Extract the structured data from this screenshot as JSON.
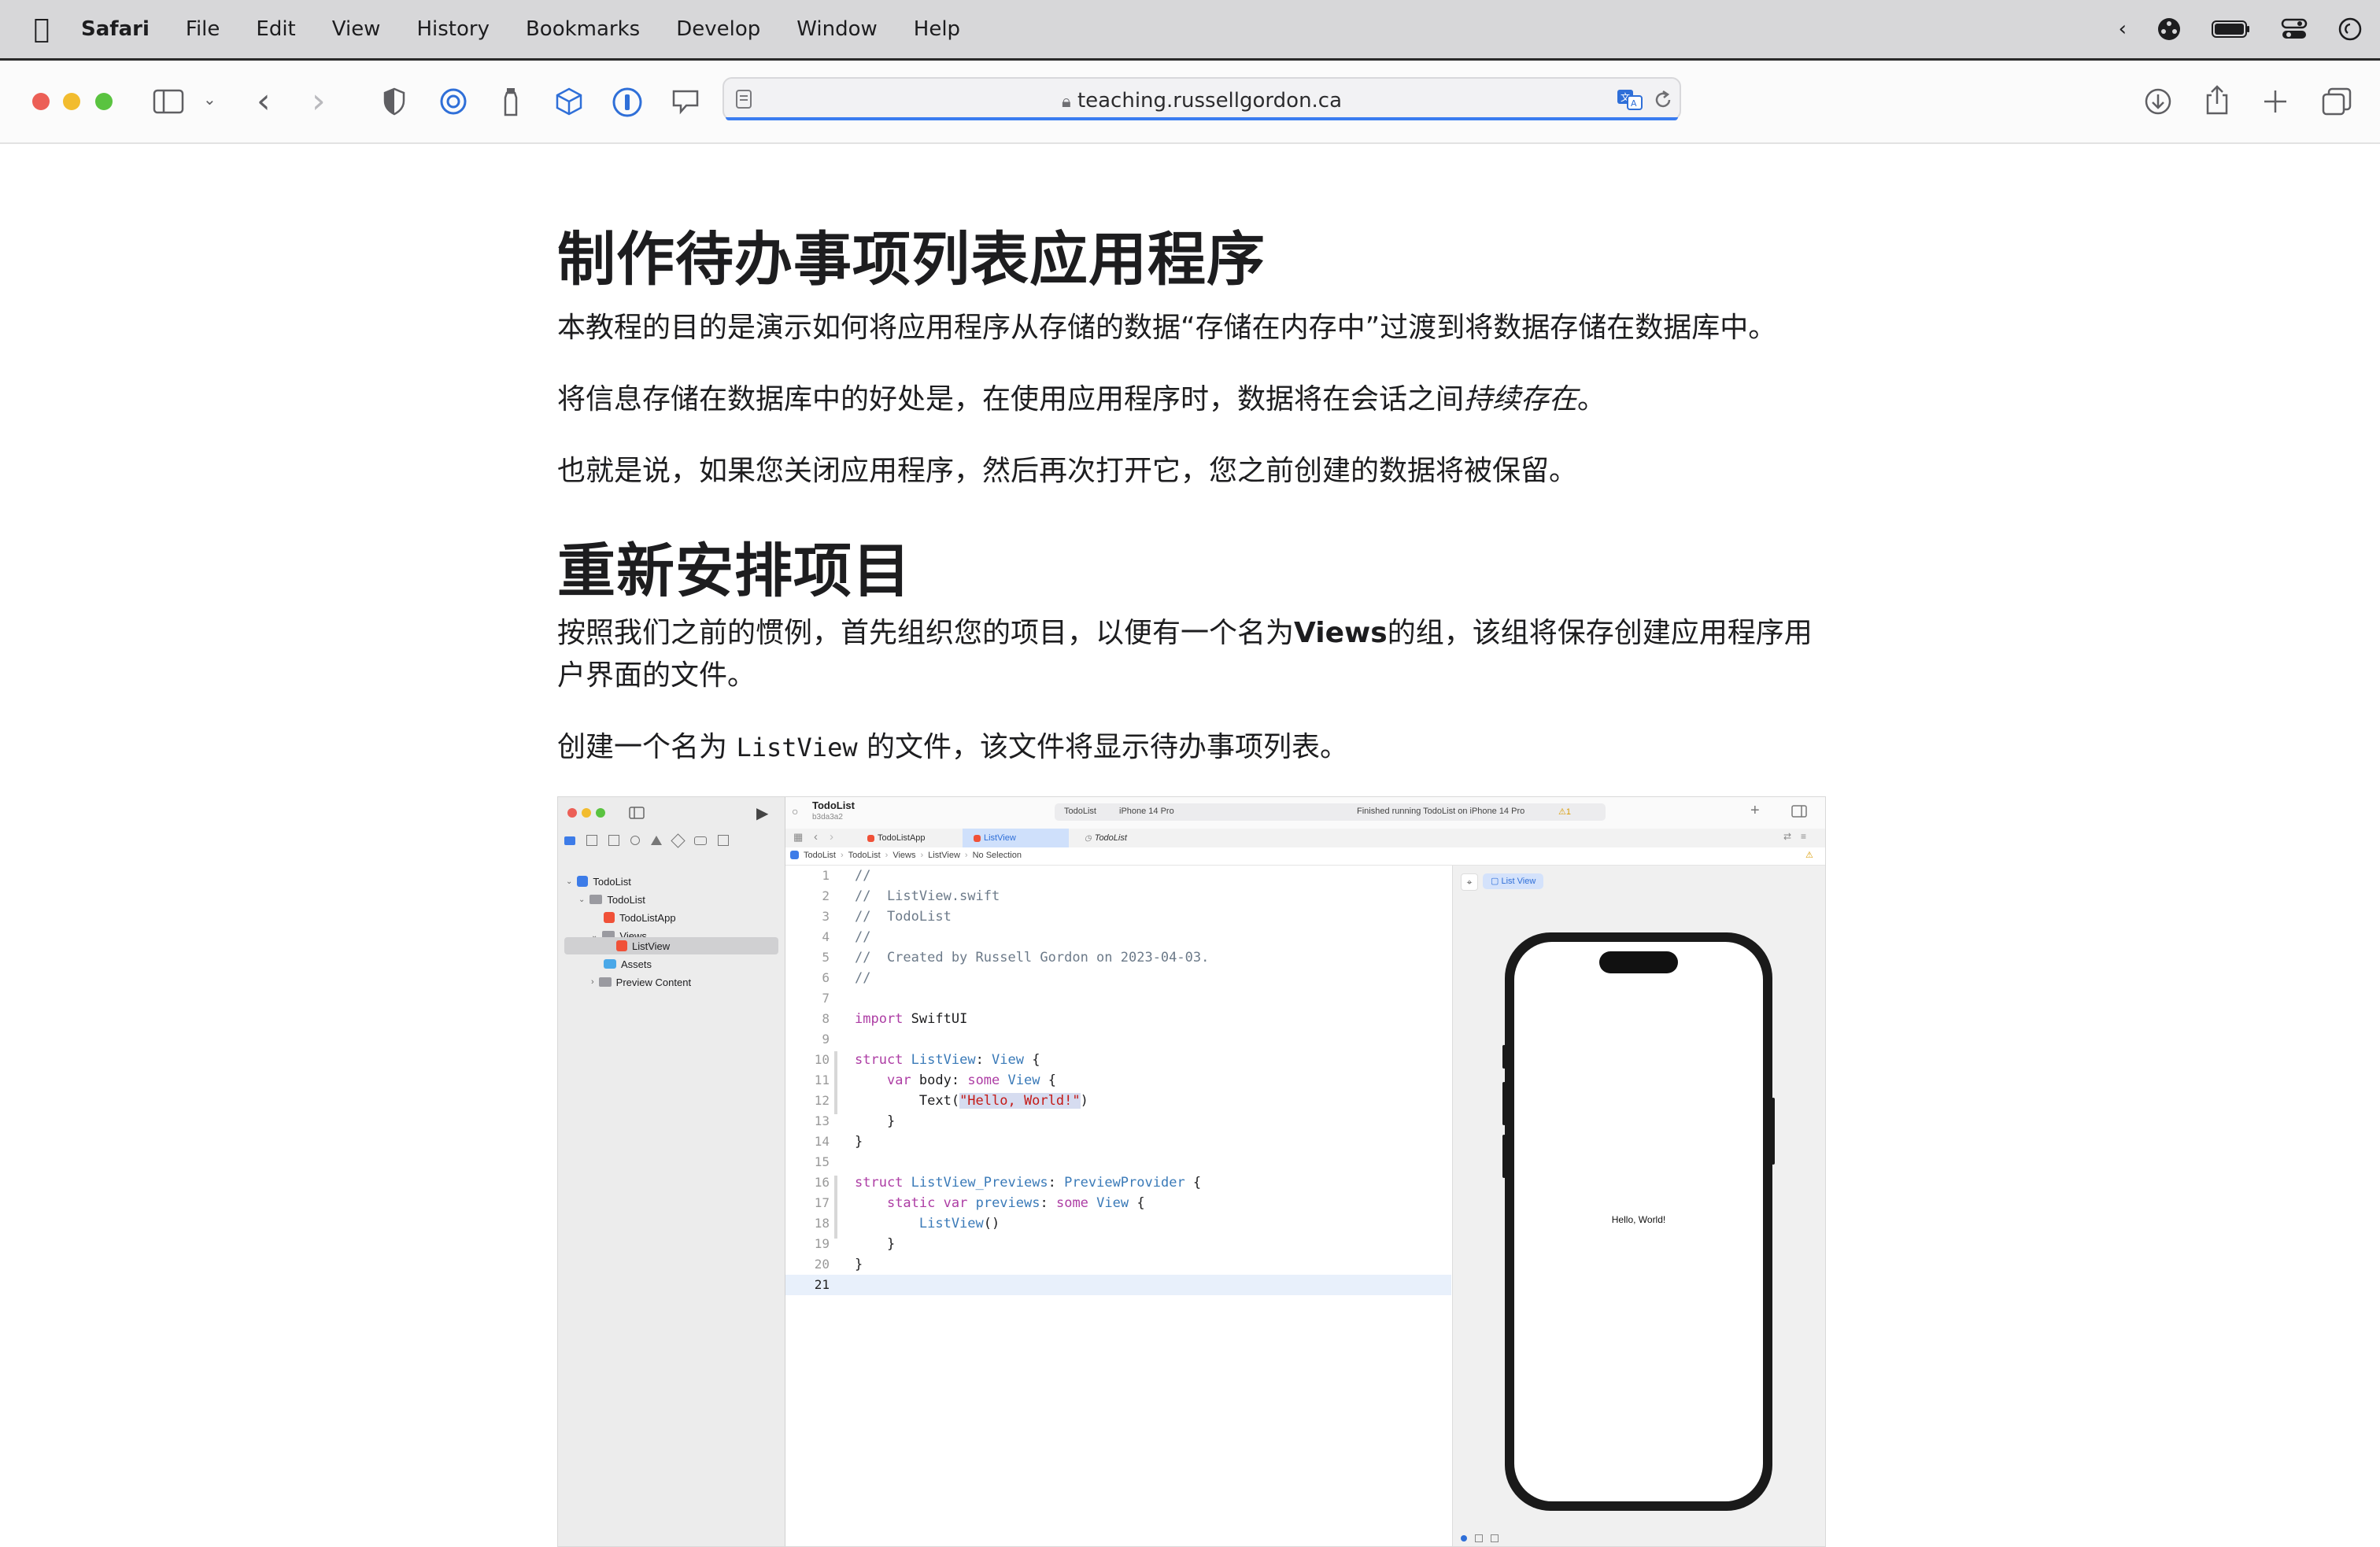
{
  "menubar": {
    "app_name": "Safari",
    "items": [
      "File",
      "Edit",
      "View",
      "History",
      "Bookmarks",
      "Develop",
      "Window",
      "Help"
    ]
  },
  "toolbar": {
    "url": "teaching.russellgordon.ca"
  },
  "article": {
    "heading1": "制作待办事项列表应用程序",
    "para1": "本教程的目的是演示如何将应用程序从存储的数据“存储在内存中”过渡到将数据存储在数据库中。",
    "para2_before": "将信息存储在数据库中的好处是，在使用应用程序时，数据将在会话之间",
    "para2_italic": "持续存在",
    "para2_after": "。",
    "para3": "也就是说，如果您关闭应用程序，然后再次打开它，您之前创建的数据将被保留。",
    "heading2": "重新安排项目",
    "para4_before": "按照我们之前的惯例，首先组织您的项目，以便有一个名为",
    "para4_bold": "Views",
    "para4_after": "的组，该组将保存创建应用程序用户界面的文件。",
    "para5_before": "创建一个名为",
    "para5_code": "ListView",
    "para5_after": "的文件，该文件将显示待办事项列表。"
  },
  "xcode": {
    "project_name": "TodoList",
    "commit": "b3da3a2",
    "scheme": "TodoList",
    "device": "iPhone 14 Pro",
    "status": "Finished running TodoList on iPhone 14 Pro",
    "warnings": "1",
    "tabs": [
      "TodoListApp",
      "ListView",
      "TodoList"
    ],
    "breadcrumb": [
      "TodoList",
      "TodoList",
      "Views",
      "ListView",
      "No Selection"
    ],
    "navigator": {
      "root": "TodoList",
      "group": "TodoList",
      "app_file": "TodoListApp",
      "views_group": "Views",
      "list_view": "ListView",
      "assets": "Assets",
      "preview_content": "Preview Content"
    },
    "code": [
      {
        "n": "1",
        "t": "//"
      },
      {
        "n": "2",
        "t": "//  ListView.swift"
      },
      {
        "n": "3",
        "t": "//  TodoList"
      },
      {
        "n": "4",
        "t": "//"
      },
      {
        "n": "5",
        "t": "//  Created by Russell Gordon on 2023-04-03."
      },
      {
        "n": "6",
        "t": "//"
      },
      {
        "n": "7",
        "t": ""
      },
      {
        "n": "8",
        "t": "import SwiftUI"
      },
      {
        "n": "9",
        "t": ""
      },
      {
        "n": "10",
        "t": "struct ListView: View {"
      },
      {
        "n": "11",
        "t": "    var body: some View {"
      },
      {
        "n": "12",
        "t": "        Text(\"Hello, World!\")"
      },
      {
        "n": "13",
        "t": "    }"
      },
      {
        "n": "14",
        "t": "}"
      },
      {
        "n": "15",
        "t": ""
      },
      {
        "n": "16",
        "t": "struct ListView_Previews: PreviewProvider {"
      },
      {
        "n": "17",
        "t": "    static var previews: some View {"
      },
      {
        "n": "18",
        "t": "        ListView()"
      },
      {
        "n": "19",
        "t": "    }"
      },
      {
        "n": "20",
        "t": "}"
      },
      {
        "n": "21",
        "t": ""
      }
    ],
    "preview_chip": "List View",
    "preview_text": "Hello, World!"
  }
}
